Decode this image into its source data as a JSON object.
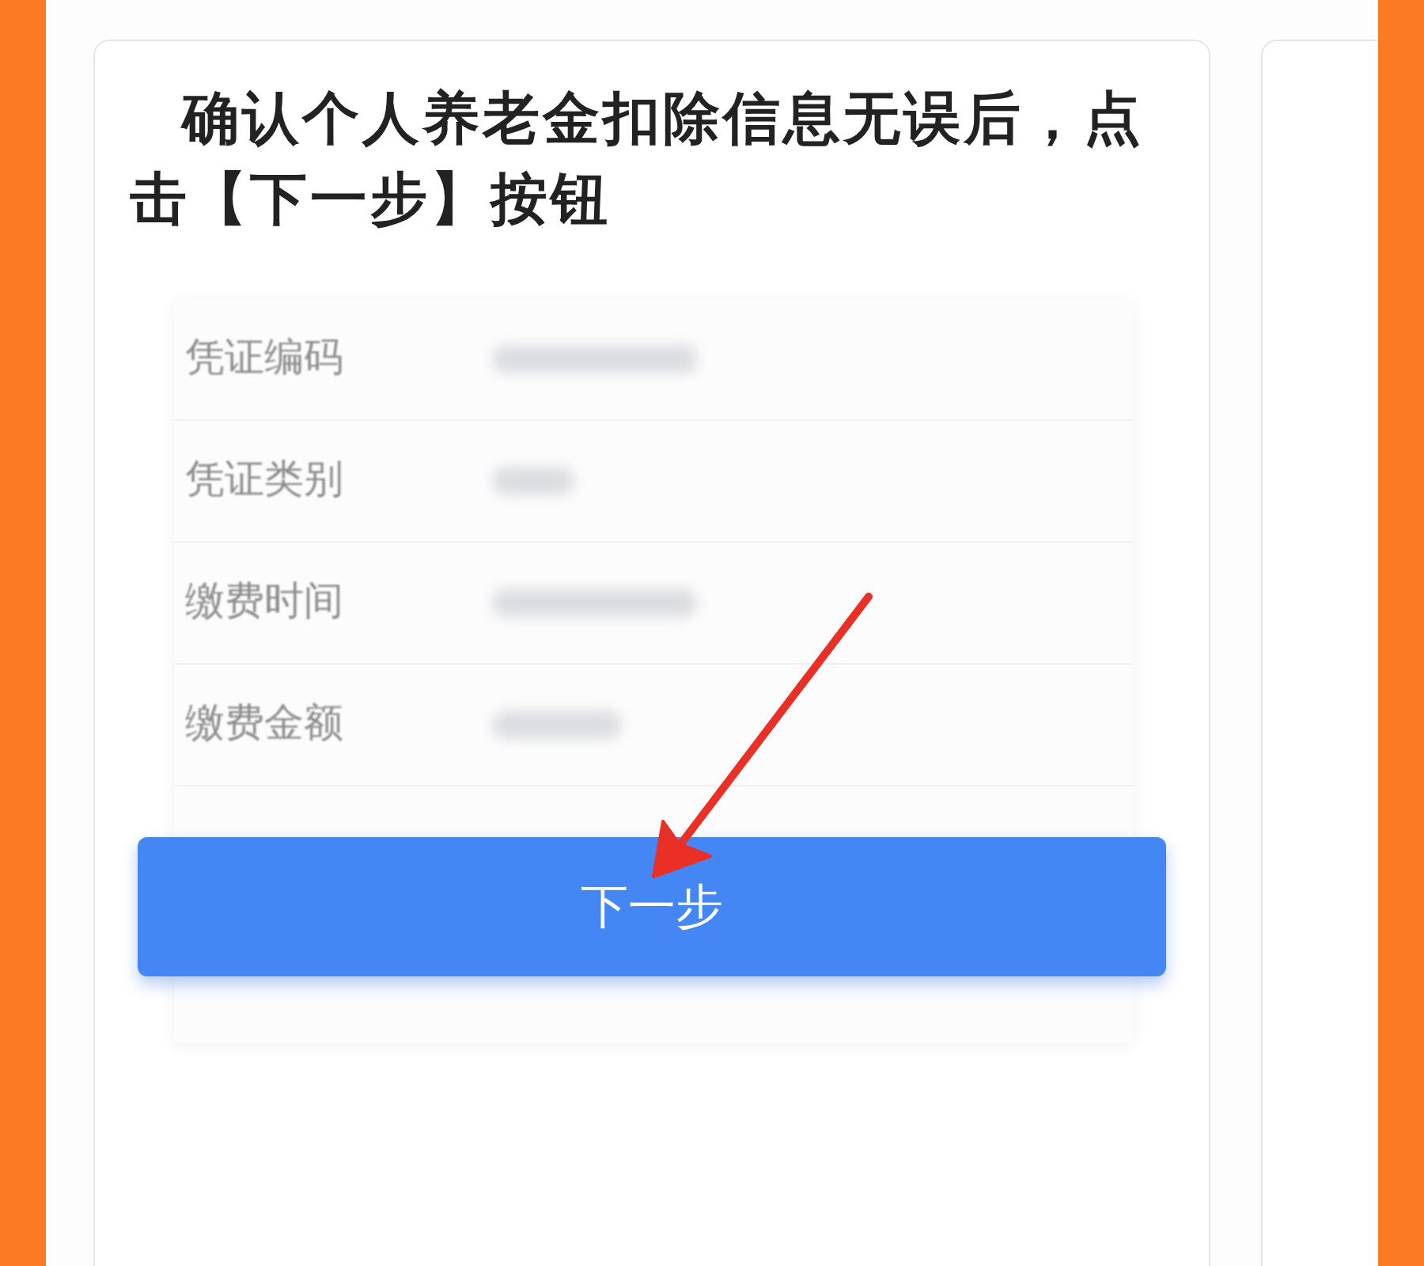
{
  "instruction": {
    "text": "确认个人养老金扣除信息无误后，点击【下一步】按钮"
  },
  "details": {
    "rows": [
      {
        "label": "凭证编码"
      },
      {
        "label": "凭证类别"
      },
      {
        "label": "缴费时间"
      },
      {
        "label": "缴费金额"
      }
    ]
  },
  "button": {
    "label": "下一步"
  }
}
